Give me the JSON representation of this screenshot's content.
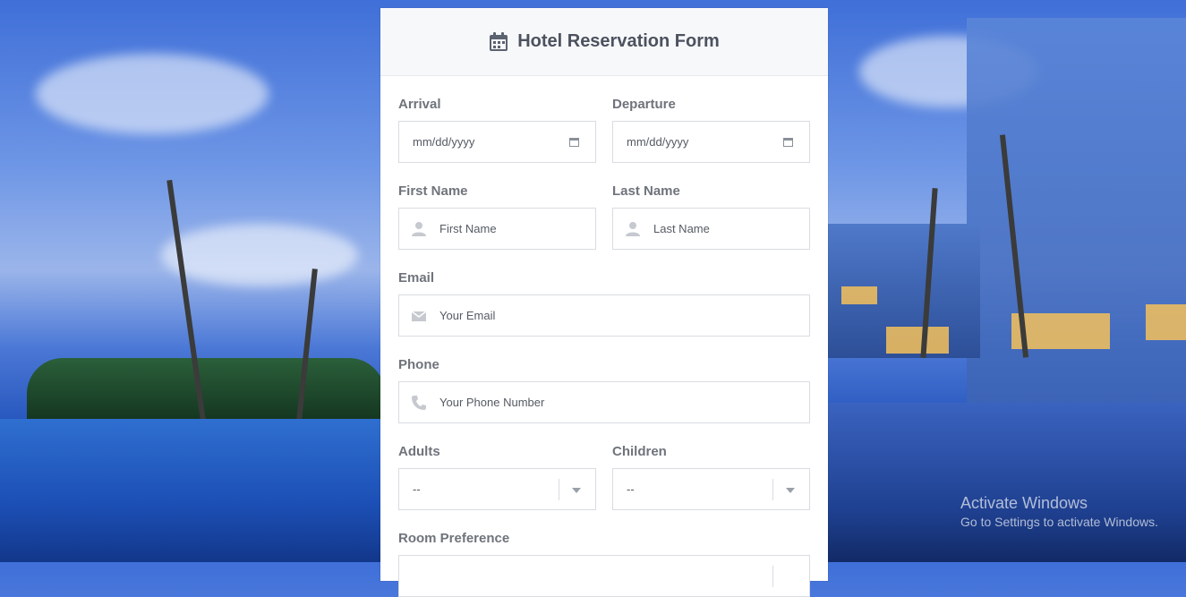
{
  "form": {
    "title": "Hotel Reservation Form",
    "title_icon": "calendar-icon",
    "accent_color": "#5b6270",
    "fields": {
      "arrival": {
        "label": "Arrival",
        "placeholder": "mm/dd/yyyy",
        "icon": "calendar-small-icon"
      },
      "departure": {
        "label": "Departure",
        "placeholder": "mm/dd/yyyy",
        "icon": "calendar-small-icon"
      },
      "first_name": {
        "label": "First Name",
        "placeholder": "First Name",
        "icon": "user-icon"
      },
      "last_name": {
        "label": "Last Name",
        "placeholder": "Last Name",
        "icon": "user-icon"
      },
      "email": {
        "label": "Email",
        "placeholder": "Your Email",
        "icon": "envelope-icon"
      },
      "phone": {
        "label": "Phone",
        "placeholder": "Your Phone Number",
        "icon": "phone-icon"
      },
      "adults": {
        "label": "Adults",
        "value": "--",
        "icon": "chevron-down-icon"
      },
      "children": {
        "label": "Children",
        "value": "--",
        "icon": "chevron-down-icon"
      },
      "room_preference": {
        "label": "Room Preference"
      }
    }
  },
  "watermark": {
    "line1": "Activate Windows",
    "line2": "Go to Settings to activate Windows."
  }
}
